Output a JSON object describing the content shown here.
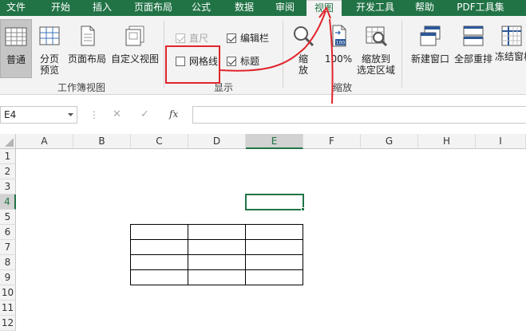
{
  "tabs": [
    "文件",
    "开始",
    "插入",
    "页面布局",
    "公式",
    "数据",
    "审阅",
    "视图",
    "开发工具",
    "帮助",
    "PDF工具集"
  ],
  "active_tab": "视图",
  "ribbon": {
    "workbook_views": {
      "normal": "普通",
      "page_break": [
        "分页",
        "预览"
      ],
      "page_layout": "页面布局",
      "custom_views": "自定义视图",
      "group_label": "工作簿视图"
    },
    "show": {
      "ruler": "直尺",
      "formula_bar": "编辑栏",
      "gridlines": "网格线",
      "headings": "标题",
      "group_label": "显示"
    },
    "zoom": {
      "zoom": [
        "缩",
        "放"
      ],
      "percent_label": "100%",
      "percent_icon_text": "100",
      "zoom_to_selection": [
        "缩放到",
        "选定区域"
      ],
      "group_label": "缩放"
    },
    "window": {
      "new_window": "新建窗口",
      "arrange_all": "全部重排",
      "freeze_panes": "冻结窗格"
    }
  },
  "formula_bar": {
    "name_box": "E4",
    "fx": "fx",
    "cancel": "✕",
    "enter": "✓",
    "more": "⋮"
  },
  "columns": [
    "A",
    "B",
    "C",
    "D",
    "E",
    "F",
    "G",
    "H",
    "I"
  ],
  "rows": [
    "1",
    "2",
    "3",
    "4",
    "5",
    "6",
    "7",
    "8",
    "9",
    "10",
    "11",
    "12"
  ],
  "active_cell": "E4",
  "colors": {
    "excel_green": "#217346",
    "annotation_red": "#e0242b"
  }
}
